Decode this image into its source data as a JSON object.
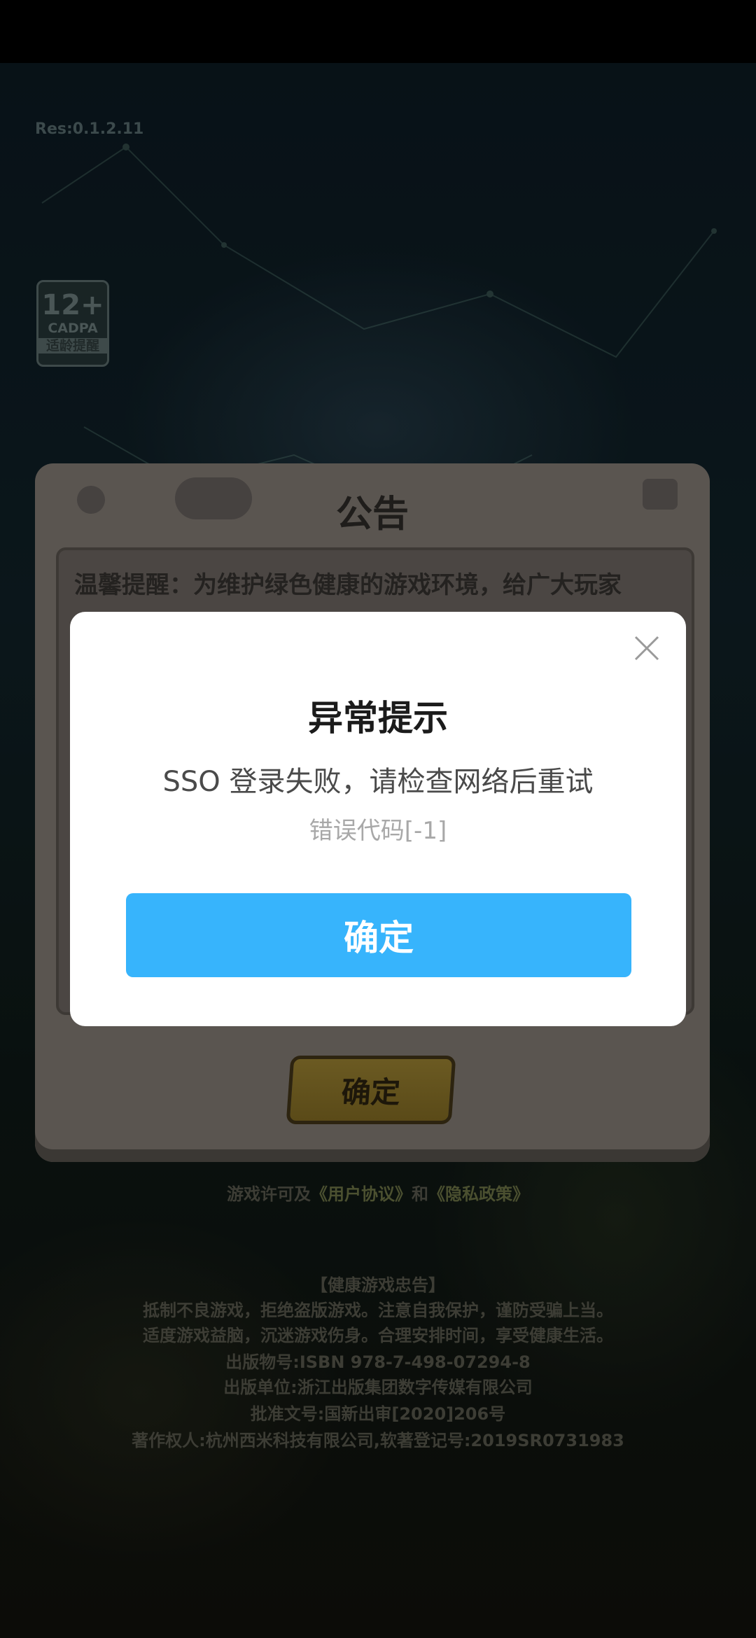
{
  "game": {
    "res_version": "Res:0.1.2.11",
    "age_badge": {
      "age": "12+",
      "org": "CADPA",
      "tip": "适龄提醒"
    }
  },
  "notice": {
    "title": "公告",
    "text": "温馨提醒：为维护绿色健康的游戏环境，给广大玩家",
    "confirm_label": "确定"
  },
  "legal": {
    "license_prefix": "游戏许可及",
    "user_agreement": "《用户协议》",
    "and": "和",
    "privacy_policy": "《隐私政策》",
    "health_title": "【健康游戏忠告】",
    "health_line1": "抵制不良游戏，拒绝盗版游戏。注意自我保护，谨防受骗上当。",
    "health_line2": "适度游戏益脑，沉迷游戏伤身。合理安排时间，享受健康生活。",
    "isbn": "出版物号:ISBN 978-7-498-07294-8",
    "publisher": "出版单位:浙江出版集团数字传媒有限公司",
    "approval": "批准文号:国新出审[2020]206号",
    "copyright": "著作权人:杭州西米科技有限公司,软著登记号:2019SR0731983"
  },
  "dialog": {
    "title": "异常提示",
    "message": "SSO 登录失败，请检查网络后重试",
    "error_code": "错误代码[-1]",
    "confirm_label": "确定",
    "close_icon": "close-icon"
  },
  "colors": {
    "primary_button": "#37b4fc",
    "dialog_bg": "#ffffff"
  }
}
